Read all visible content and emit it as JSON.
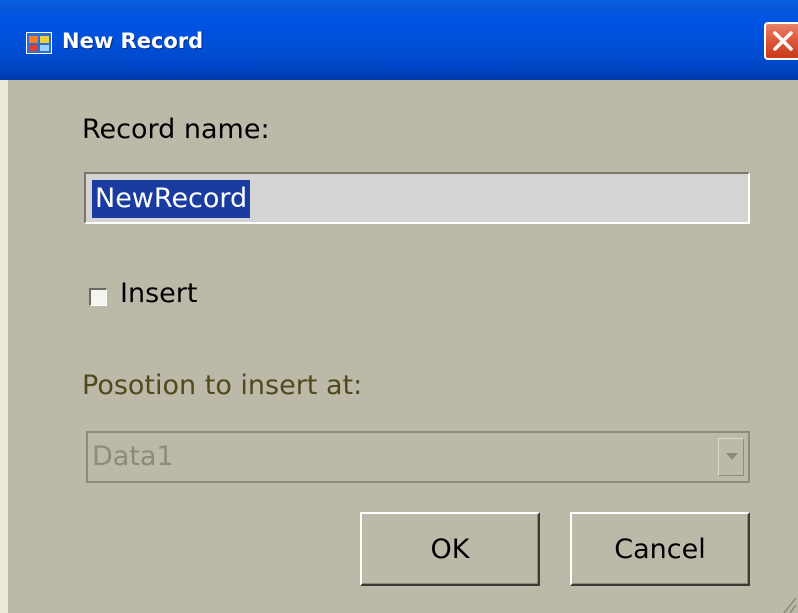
{
  "window": {
    "title": "New Record",
    "app_icon": "app-window-icon",
    "close_icon": "close-icon"
  },
  "form": {
    "record_name_label": "Record name:",
    "record_name_value": "NewRecord",
    "insert_label": "Insert",
    "insert_checked": false,
    "position_label": "Posotion to insert at:",
    "position_value": "Data1",
    "position_enabled": false
  },
  "buttons": {
    "ok_label": "OK",
    "cancel_label": "Cancel"
  },
  "colors": {
    "titlebar": "#0054e3",
    "dialog_face": "#bcb9a9",
    "selection": "#1a3ca0",
    "close_button": "#dd5a3c",
    "disabled_label": "#4f4a1e"
  }
}
